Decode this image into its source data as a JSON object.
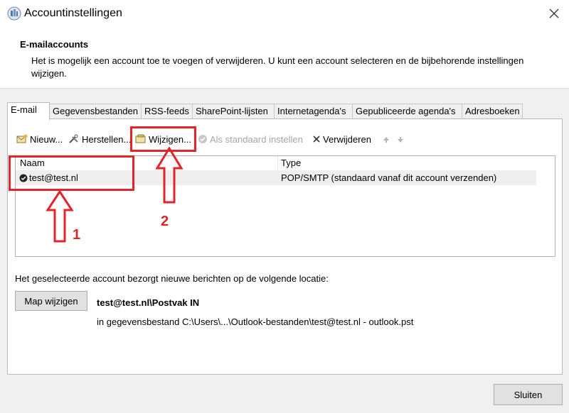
{
  "window": {
    "title": "Accountinstellingen",
    "close_icon": "close-icon"
  },
  "header": {
    "title": "E-mailaccounts",
    "description": "Het is mogelijk een account toe te voegen of verwijderen. U kunt een account selecteren en de bijbehorende instellingen wijzigen."
  },
  "tabs": [
    "E-mail",
    "Gegevensbestanden",
    "RSS-feeds",
    "SharePoint-lijsten",
    "Internetagenda's",
    "Gepubliceerde agenda's",
    "Adresboeken"
  ],
  "active_tab": "E-mail",
  "toolbar": {
    "new": "Nieuw...",
    "repair": "Herstellen...",
    "change": "Wijzigen...",
    "set_default": "Als standaard instellen",
    "remove": "Verwijderen"
  },
  "accounts_table": {
    "columns": [
      "Naam",
      "Type"
    ],
    "rows": [
      {
        "name": "test@test.nl",
        "type": "POP/SMTP (standaard vanaf dit account verzenden)",
        "is_default": true
      }
    ]
  },
  "delivery": {
    "label": "Het geselecteerde account bezorgt nieuwe berichten op de volgende locatie:",
    "change_folder_button": "Map wijzigen",
    "folder_path": "test@test.nl\\Postvak IN",
    "data_file": "in gegevensbestand C:\\Users\\...\\Outlook-bestanden\\test@test.nl - outlook.pst"
  },
  "footer": {
    "close_button": "Sluiten"
  },
  "annotations": {
    "marker_1": "1",
    "marker_2": "2"
  },
  "colors": {
    "annotation_red": "#e0262b",
    "panel_bg": "#f0f0f0"
  }
}
